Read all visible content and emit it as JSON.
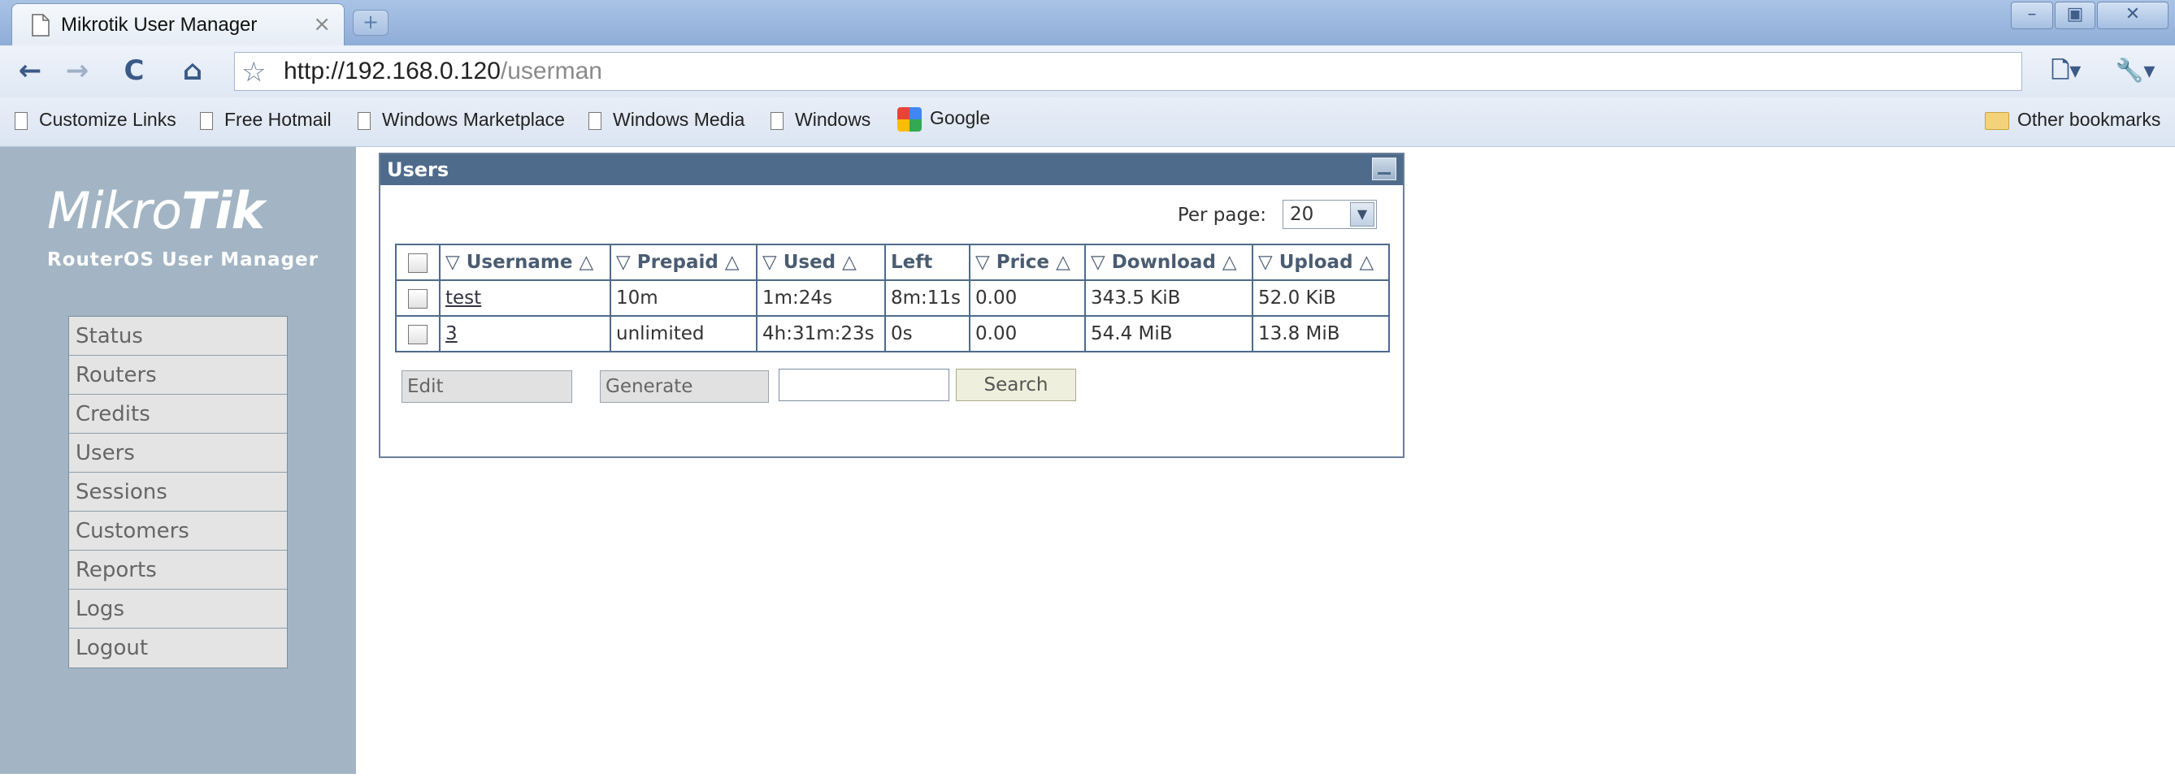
{
  "browser": {
    "tab_title": "Mikrotik User Manager",
    "tab_close": "×",
    "new_tab": "+",
    "url_host": "http://192.168.0.120",
    "url_path": "/userman",
    "nav": {
      "back": "←",
      "forward": "→",
      "reload": "C",
      "home": "⌂"
    },
    "window_buttons": {
      "minimize": "–",
      "maximize": "▣",
      "close": "✕"
    },
    "right_icons": {
      "play": "▶",
      "page": "🗋▾",
      "wrench": "🔧▾"
    }
  },
  "bookmarks": {
    "items": [
      "Customize Links",
      "Free Hotmail",
      "Windows Marketplace",
      "Windows Media",
      "Windows",
      "Google"
    ],
    "other": "Other bookmarks"
  },
  "sidebar": {
    "logo_mikro": "Mikro",
    "logo_tik": "Tik",
    "subtitle": "RouterOS User Manager",
    "items": [
      "Status",
      "Routers",
      "Credits",
      "Users",
      "Sessions",
      "Customers",
      "Reports",
      "Logs",
      "Logout"
    ]
  },
  "panel": {
    "title": "Users",
    "per_page_label": "Per page:",
    "per_page_value": "20",
    "columns": [
      "Username",
      "Prepaid",
      "Used",
      "Left",
      "Price",
      "Download",
      "Upload"
    ],
    "sort_desc": "▽",
    "sort_asc": "△",
    "rows": [
      {
        "username": "test",
        "prepaid": "10m",
        "used": "1m:24s",
        "left": "8m:11s",
        "price": "0.00",
        "download": "343.5 KiB",
        "upload": "52.0 KiB"
      },
      {
        "username": "3",
        "prepaid": "unlimited",
        "used": "4h:31m:23s",
        "left": "0s",
        "price": "0.00",
        "download": "54.4 MiB",
        "upload": "13.8 MiB"
      }
    ],
    "edit_label": "Edit",
    "generate_label": "Generate",
    "search_value": "",
    "search_label": "Search"
  }
}
